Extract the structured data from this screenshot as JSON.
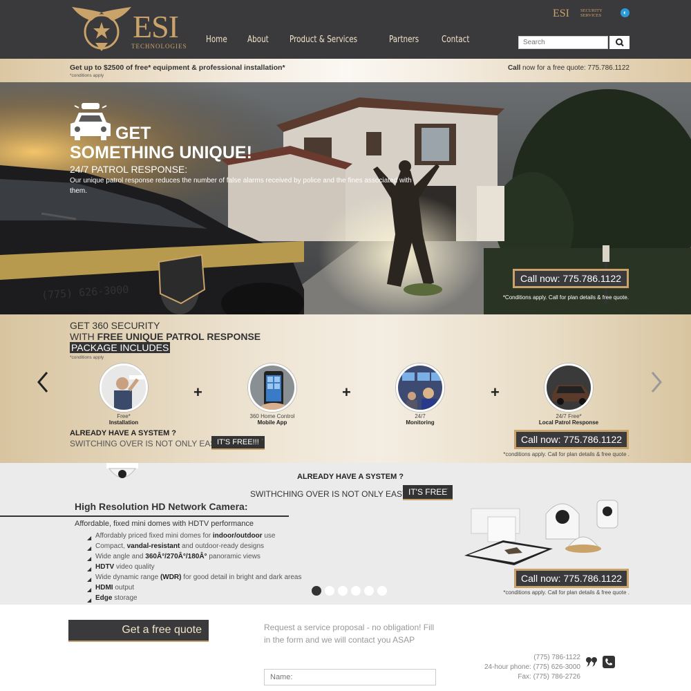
{
  "header": {
    "logo_name": "ESI",
    "logo_sub": "TECHNOLOGIES",
    "nav": [
      "Home",
      "About",
      "Product & Services",
      "Partners",
      "Contact"
    ],
    "partner_logo_name": "ESI",
    "partner_logo_sub": "SECURITY SERVICES",
    "search_placeholder": "Search"
  },
  "promo": {
    "text": "Get up to $2500 of free* equipment & professional installation*",
    "conditions": "*conditions apply",
    "call_bold": "Call",
    "call_rest": " now for a free quote: 775.786.1122"
  },
  "hero": {
    "heading_1": "GET",
    "heading_2": "SOMETHING UNIQUE!",
    "subheading": "24/7 PATROL RESPONSE:",
    "description": "Our unique patrol response reduces the number of false alarms received by police and the fines associated with them.",
    "car_number": "(775) 626-3000",
    "cta": "Call now: 775.786.1122",
    "note": "*Conditions apply. Call for plan details & free quote."
  },
  "package": {
    "line1": "GET 360 SECURITY",
    "line2_prefix": "WITH ",
    "line2_bold": "FREE UNIQUE PATROL RESPONSE",
    "line3": "PACKAGE INCLUDES",
    "conditions": "*conditions apply",
    "features": [
      {
        "line1": "Free*",
        "line2": "Installation"
      },
      {
        "line1": "360 Home Control",
        "line2": "Mobile App"
      },
      {
        "line1": "24/7",
        "line2": "Monitoring"
      },
      {
        "line1": "24/7 Free*",
        "line2": "Local Patrol Response"
      }
    ],
    "plus": "+",
    "have_system": "ALREADY HAVE A SYSTEM ?",
    "switch_text": "SWITCHING OVER IS NOT ONLY EASY...",
    "free_label": "IT'S FREE!!!",
    "free_mark": "*",
    "cta": "Call now: 775.786.1122",
    "note": "*conditions apply. Call for plan details & free quote ."
  },
  "camera": {
    "have_system": "ALREADY HAVE A SYSTEM ?",
    "switch_text": "SWITHCHING OVER IS NOT ONLY EASY ...",
    "free_label": "IT'S FREE",
    "free_mark": "*",
    "title": "High Resolution HD Network Camera:",
    "subtitle": "Affordable, fixed mini domes with HDTV performance",
    "features": [
      {
        "pre": "Affordably priced fixed mini domes for ",
        "bold": "indoor/outdoor",
        "post": " use"
      },
      {
        "pre": "Compact, ",
        "bold": "vandal-resistant",
        "post": " and outdoor-ready designs"
      },
      {
        "pre": "Wide angle and ",
        "bold": "360Â°/270Â°/180Â°",
        "post": " panoramic views"
      },
      {
        "pre": "",
        "bold": "HDTV",
        "post": " video quality"
      },
      {
        "pre": "Wide dynamic range ",
        "bold": "(WDR)",
        "post": " for good detail in bright and dark areas"
      },
      {
        "pre": "",
        "bold": "HDMI",
        "post": " output"
      },
      {
        "pre": "",
        "bold": "Edge",
        "post": " storage"
      }
    ],
    "cta": "Call now: 775.786.1122",
    "note": "*conditions apply. Call for plan details & free quote .",
    "slides_total": 6,
    "slide_active": 1
  },
  "footer": {
    "quote_button": "Get a free quote",
    "request_text": "Request a service proposal - no obligation! Fill in the form and we will contact you ASAP",
    "name_placeholder": "Name:",
    "phone": "(775) 786-1122",
    "hour_phone": "24-hour phone: (775) 626-3000",
    "fax": "Fax: (775) 786-2726"
  },
  "colors": {
    "dark": "#3a3a3d",
    "gold": "#c9a36a",
    "light_bg": "#ebebeb"
  }
}
